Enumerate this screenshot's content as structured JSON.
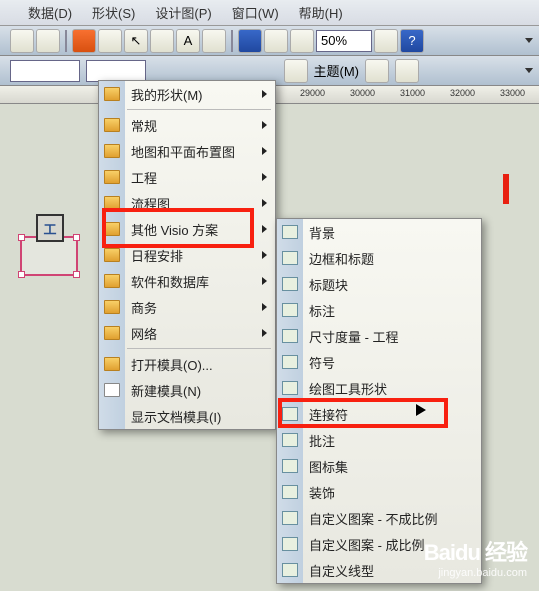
{
  "menubar": {
    "data": "数据(D)",
    "shape": "形状(S)",
    "view": "设计图(P)",
    "window": "窗口(W)",
    "help": "帮助(H)"
  },
  "toolbar": {
    "zoom": "50%",
    "theme_label": "主题(M)"
  },
  "ruler": {
    "m1": "29000",
    "m2": "30000",
    "m3": "31000",
    "m4": "32000",
    "m5": "33000"
  },
  "tshape": "工",
  "menu1": {
    "myshapes": "我的形状(M)",
    "normal": "常规",
    "map": "地图和平面布置图",
    "eng": "工程",
    "flow": "流程图",
    "other": "其他 Visio 方案",
    "schedule": "日程安排",
    "software": "软件和数据库",
    "business": "商务",
    "network": "网络",
    "opentpl": "打开模具(O)...",
    "newtpl": "新建模具(N)",
    "showdoc": "显示文档模具(I)"
  },
  "menu2": {
    "bg": "背景",
    "border": "边框和标题",
    "titleblk": "标题块",
    "callout": "标注",
    "dim": "尺寸度量 - 工程",
    "symbol": "符号",
    "drawtool": "绘图工具形状",
    "connector": "连接符",
    "annot": "批注",
    "iconset": "图标集",
    "decor": "装饰",
    "custpat": "自定义图案 - 不成比例",
    "custpat2": "自定义图案 - 成比例",
    "custline": "自定义线型"
  },
  "watermark": {
    "brand": "Baidu 经验",
    "url": "jingyan.baidu.com"
  }
}
